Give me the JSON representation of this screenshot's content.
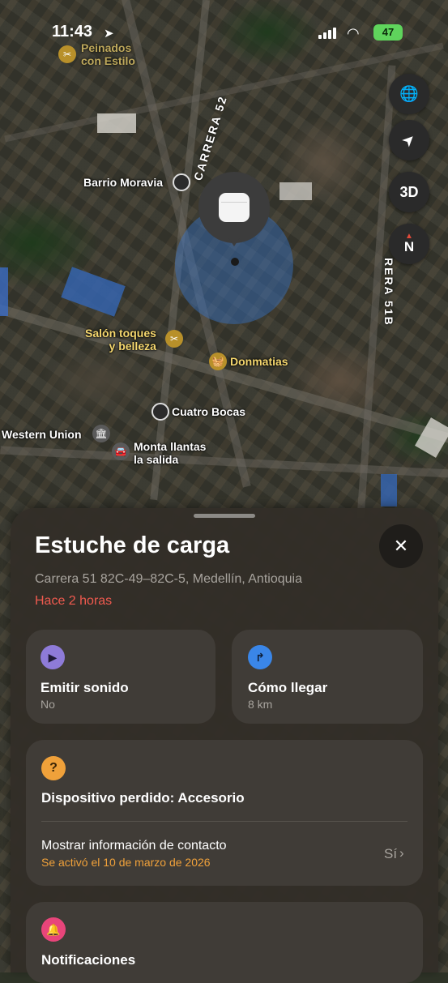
{
  "status_bar": {
    "time": "11:43",
    "battery": "47"
  },
  "map": {
    "labels": {
      "peinados": "Peinados\ncon Estilo",
      "barrio": "Barrio Moravia",
      "salon": "Salón toques\ny belleza",
      "donmatias": "Donmatias",
      "cuatro_bocas": "Cuatro Bocas",
      "western_union": "Western Union",
      "monta_llantas": "Monta llantas\nla salida",
      "carrera52": "CARRERA 52",
      "carrera51b": "RERA 51B"
    },
    "controls": {
      "three_d": "3D",
      "compass": "N"
    }
  },
  "sheet": {
    "title": "Estuche de carga",
    "address": "Carrera 51 82C-49–82C-5, Medellín, Antioquia",
    "last_seen": "Hace 2 horas",
    "play_sound": {
      "title": "Emitir sonido",
      "subtitle": "No"
    },
    "directions": {
      "title": "Cómo llegar",
      "subtitle": "8 km"
    },
    "lost_mode": {
      "title": "Dispositivo perdido: Accesorio",
      "contact_label": "Mostrar información de contacto",
      "contact_sub": "Se activó el 10 de marzo de 2026",
      "contact_value": "Sí"
    },
    "notifications": {
      "title": "Notificaciones"
    }
  },
  "colors": {
    "accent_purple": "#8e7bd8",
    "accent_blue": "#3a86e8",
    "accent_orange": "#f0a13a",
    "accent_pink": "#e8457a",
    "alert_red": "#f05a4f"
  }
}
